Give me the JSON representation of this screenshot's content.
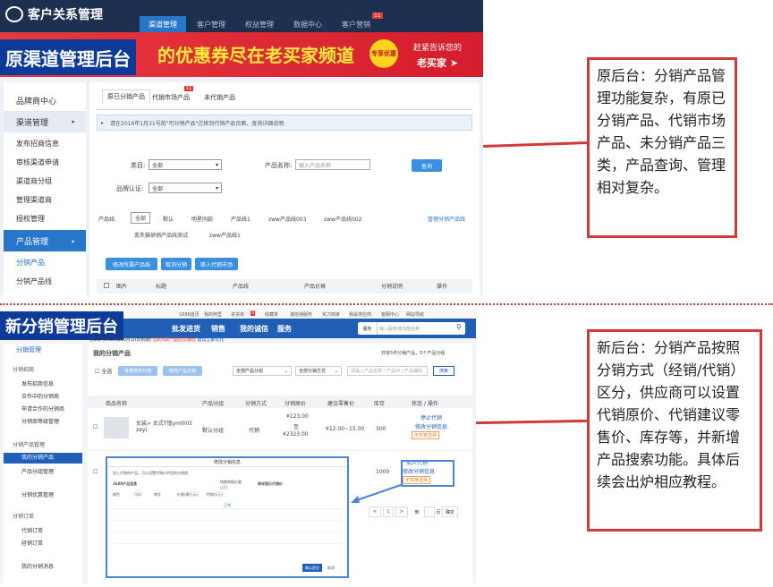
{
  "old": {
    "app_title": "客户关系管理",
    "tabs": [
      "渠道管理",
      "客户管理",
      "权益管理",
      "数据中心",
      "客户营销"
    ],
    "tab_badge": "11",
    "label": "原渠道管理后台",
    "banner": {
      "promo": "的优惠券尽在老买家频道",
      "badge": "专享优惠",
      "right1": "赶紧告诉您的",
      "right2": "老买家"
    },
    "sidebar": [
      "品牌商中心",
      "渠道管理",
      "发布招商信息",
      "审核渠道申请",
      "渠道商分组",
      "管理渠道商",
      "授权管理",
      "产品管理",
      "分销产品",
      "分销产品线"
    ],
    "product_tabs": [
      "原已分销产品",
      "代销市场产品",
      "未代销产品"
    ],
    "product_tab_badge": "11",
    "notice": "请在2016年1月31号前\"可分销产品\"迁移到代销产品页面，查询详细说明",
    "filters": {
      "category_label": "类目:",
      "category_value": "全部",
      "name_label": "产品名称:",
      "name_placeholder": "输入产品名称",
      "brand_label": "品牌认证:",
      "brand_value": "全部",
      "query": "查询"
    },
    "product_line_label": "产品线:",
    "product_lines": [
      "全部",
      "默认",
      "明星同款",
      "产品线1",
      "zww产品线003",
      "zww产品线002"
    ],
    "product_lines2": [
      "丢失猫供销产品线测试",
      "zww产品线1"
    ],
    "manage_line": "管理分销产品线",
    "actions": [
      "修改所属产品线",
      "取消分销",
      "移入代销市场"
    ],
    "columns": [
      "图片",
      "标题",
      "产品线",
      "产品价格",
      "分销说明",
      "操作"
    ]
  },
  "new": {
    "label": "新分销管理后台",
    "topbar": [
      "1688首页",
      "我的阿里",
      "进货单",
      "收藏夹",
      "诚信通服务",
      "实力商家",
      "我是供应商",
      "客服中心",
      "网站导航"
    ],
    "topbar_badge": "0",
    "nav": [
      "批发进货",
      "销售",
      "我的诚信",
      "服务"
    ],
    "search_label": "服务",
    "search_placeholder": "输入服务或功能名称",
    "sidebar": [
      "分销管理",
      "分销招商",
      "发布招商信息",
      "合作中的分销商",
      "申请合作的分销商",
      "分销商等级管理",
      "分销产品管理",
      "我的分销产品",
      "产品分组管理",
      "分销优惠管理",
      "分销订单",
      "代销订单",
      "经销订单",
      "我的分销消息"
    ],
    "notice_strong": "第1年 (2020年10月10日到期)",
    "notice_red": "您的5款产品信息偏低",
    "notice_link": "建议立即优化",
    "section_title": "我的分销产品",
    "count_text": "共有5件分销产品，5个产品分组",
    "select_all": "全选",
    "bulk_buttons": [
      "批量修改分销",
      "修改产品分组"
    ],
    "filter_group": "全部产品分组",
    "filter_mode": "全部分销方式",
    "filter_placeholder": "请输入产品名称 / 产品ID / 产品编码",
    "search_btn": "搜索",
    "columns": [
      "商品名称",
      "产品分组",
      "分销方式",
      "分销原价",
      "建议零售价",
      "库存",
      "状态 / 操作"
    ],
    "row": {
      "name": "女装> 女式T恤yml005 zeyi",
      "group": "默认分组",
      "mode": "代销",
      "price1": "¥123.00",
      "price_to": "至",
      "price2": "¥2323.00",
      "retail": "¥12.00~15.00",
      "stock": "300",
      "op1": "停止代销",
      "op2": "修改分销信息",
      "tag": "无买家选择"
    },
    "row2": {
      "stock": "1000",
      "op1": "加入代销",
      "op2": "修改分销信息",
      "tag": "无买家选择"
    },
    "modal": {
      "title": "修改分销信息",
      "hint": "加入代销的产品，可以设置代销价供您的分销商",
      "left_head": "1688产品信息",
      "mid_head": "销售商报价截止日",
      "right_head": "库存提示代销价",
      "sub_cols": [
        "颜色",
        "尺码",
        "库存",
        "价格(建行元)",
        "代销价(元)"
      ],
      "status": "正常",
      "confirm": "确认提交",
      "cancel": "取消"
    },
    "pager": {
      "prev": "<",
      "page": "1",
      "next": ">",
      "go": "到",
      "unit": "页",
      "ok": "确定"
    }
  },
  "callouts": {
    "old": "原后台：分销产品管理功能复杂，有原已分销产品、代销市场产品、未分销产品三类，产品查询、管理相对复杂。",
    "new": "新后台：分销产品按照分销方式（经销/代销）区分，供应商可以设置代销原价、代销建议零售价、库存等，并新增产品搜索功能。具体后续会出炉相应教程。"
  }
}
